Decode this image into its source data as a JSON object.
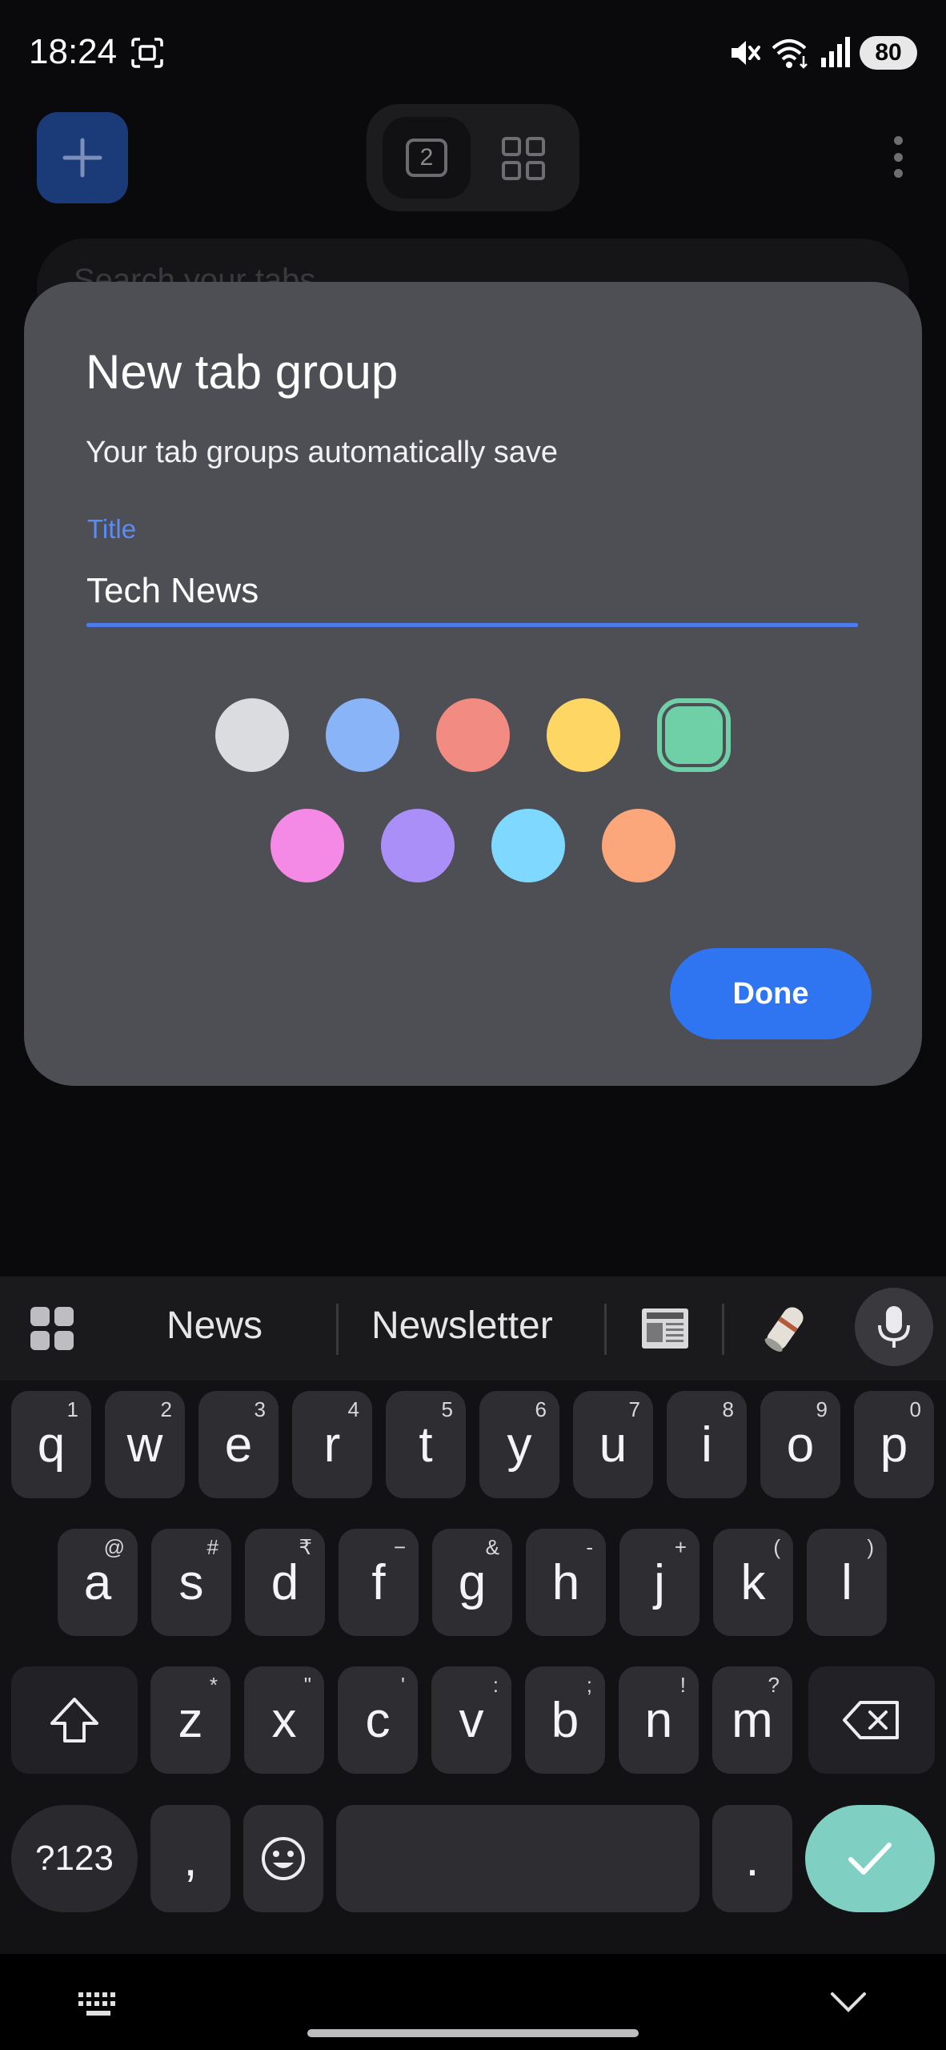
{
  "status_bar": {
    "time": "18:24",
    "battery": "80",
    "icons": [
      "screenshot-icon",
      "mute-icon",
      "wifi-icon",
      "signal-icon",
      "battery-icon"
    ]
  },
  "browser": {
    "new_tab_icon": "plus-icon",
    "tab_count": "2",
    "search_placeholder": "Search your tabs"
  },
  "dialog": {
    "title": "New tab group",
    "subtitle": "Your tab groups automatically save",
    "field_label": "Title",
    "field_value": "Tech News",
    "colors": [
      {
        "name": "grey",
        "hex": "#dadce0",
        "selected": false
      },
      {
        "name": "blue",
        "hex": "#8ab4f8",
        "selected": false
      },
      {
        "name": "red",
        "hex": "#f28b82",
        "selected": false
      },
      {
        "name": "yellow",
        "hex": "#fdd663",
        "selected": false
      },
      {
        "name": "green",
        "hex": "#6fd0a8",
        "selected": true
      },
      {
        "name": "pink",
        "hex": "#f48ae6",
        "selected": false
      },
      {
        "name": "purple",
        "hex": "#ab8ff9",
        "selected": false
      },
      {
        "name": "cyan",
        "hex": "#7fd8ff",
        "selected": false
      },
      {
        "name": "orange",
        "hex": "#fca77b",
        "selected": false
      }
    ],
    "done_label": "Done"
  },
  "keyboard": {
    "suggestions": [
      "News",
      "Newsletter"
    ],
    "emoji_suggestions": [
      "newspaper-emoji",
      "rolled-newspaper-emoji"
    ],
    "row1": [
      {
        "key": "q",
        "hint": "1"
      },
      {
        "key": "w",
        "hint": "2"
      },
      {
        "key": "e",
        "hint": "3"
      },
      {
        "key": "r",
        "hint": "4"
      },
      {
        "key": "t",
        "hint": "5"
      },
      {
        "key": "y",
        "hint": "6"
      },
      {
        "key": "u",
        "hint": "7"
      },
      {
        "key": "i",
        "hint": "8"
      },
      {
        "key": "o",
        "hint": "9"
      },
      {
        "key": "p",
        "hint": "0"
      }
    ],
    "row2": [
      {
        "key": "a",
        "hint": "@"
      },
      {
        "key": "s",
        "hint": "#"
      },
      {
        "key": "d",
        "hint": "₹"
      },
      {
        "key": "f",
        "hint": "−"
      },
      {
        "key": "g",
        "hint": "&"
      },
      {
        "key": "h",
        "hint": "-"
      },
      {
        "key": "j",
        "hint": "+"
      },
      {
        "key": "k",
        "hint": "("
      },
      {
        "key": "l",
        "hint": ")"
      }
    ],
    "row3": [
      {
        "key": "z",
        "hint": "*"
      },
      {
        "key": "x",
        "hint": "\""
      },
      {
        "key": "c",
        "hint": "'"
      },
      {
        "key": "v",
        "hint": ":"
      },
      {
        "key": "b",
        "hint": ";"
      },
      {
        "key": "n",
        "hint": "!"
      },
      {
        "key": "m",
        "hint": "?"
      }
    ],
    "symbols_label": "?123",
    "comma": ",",
    "period": "."
  }
}
